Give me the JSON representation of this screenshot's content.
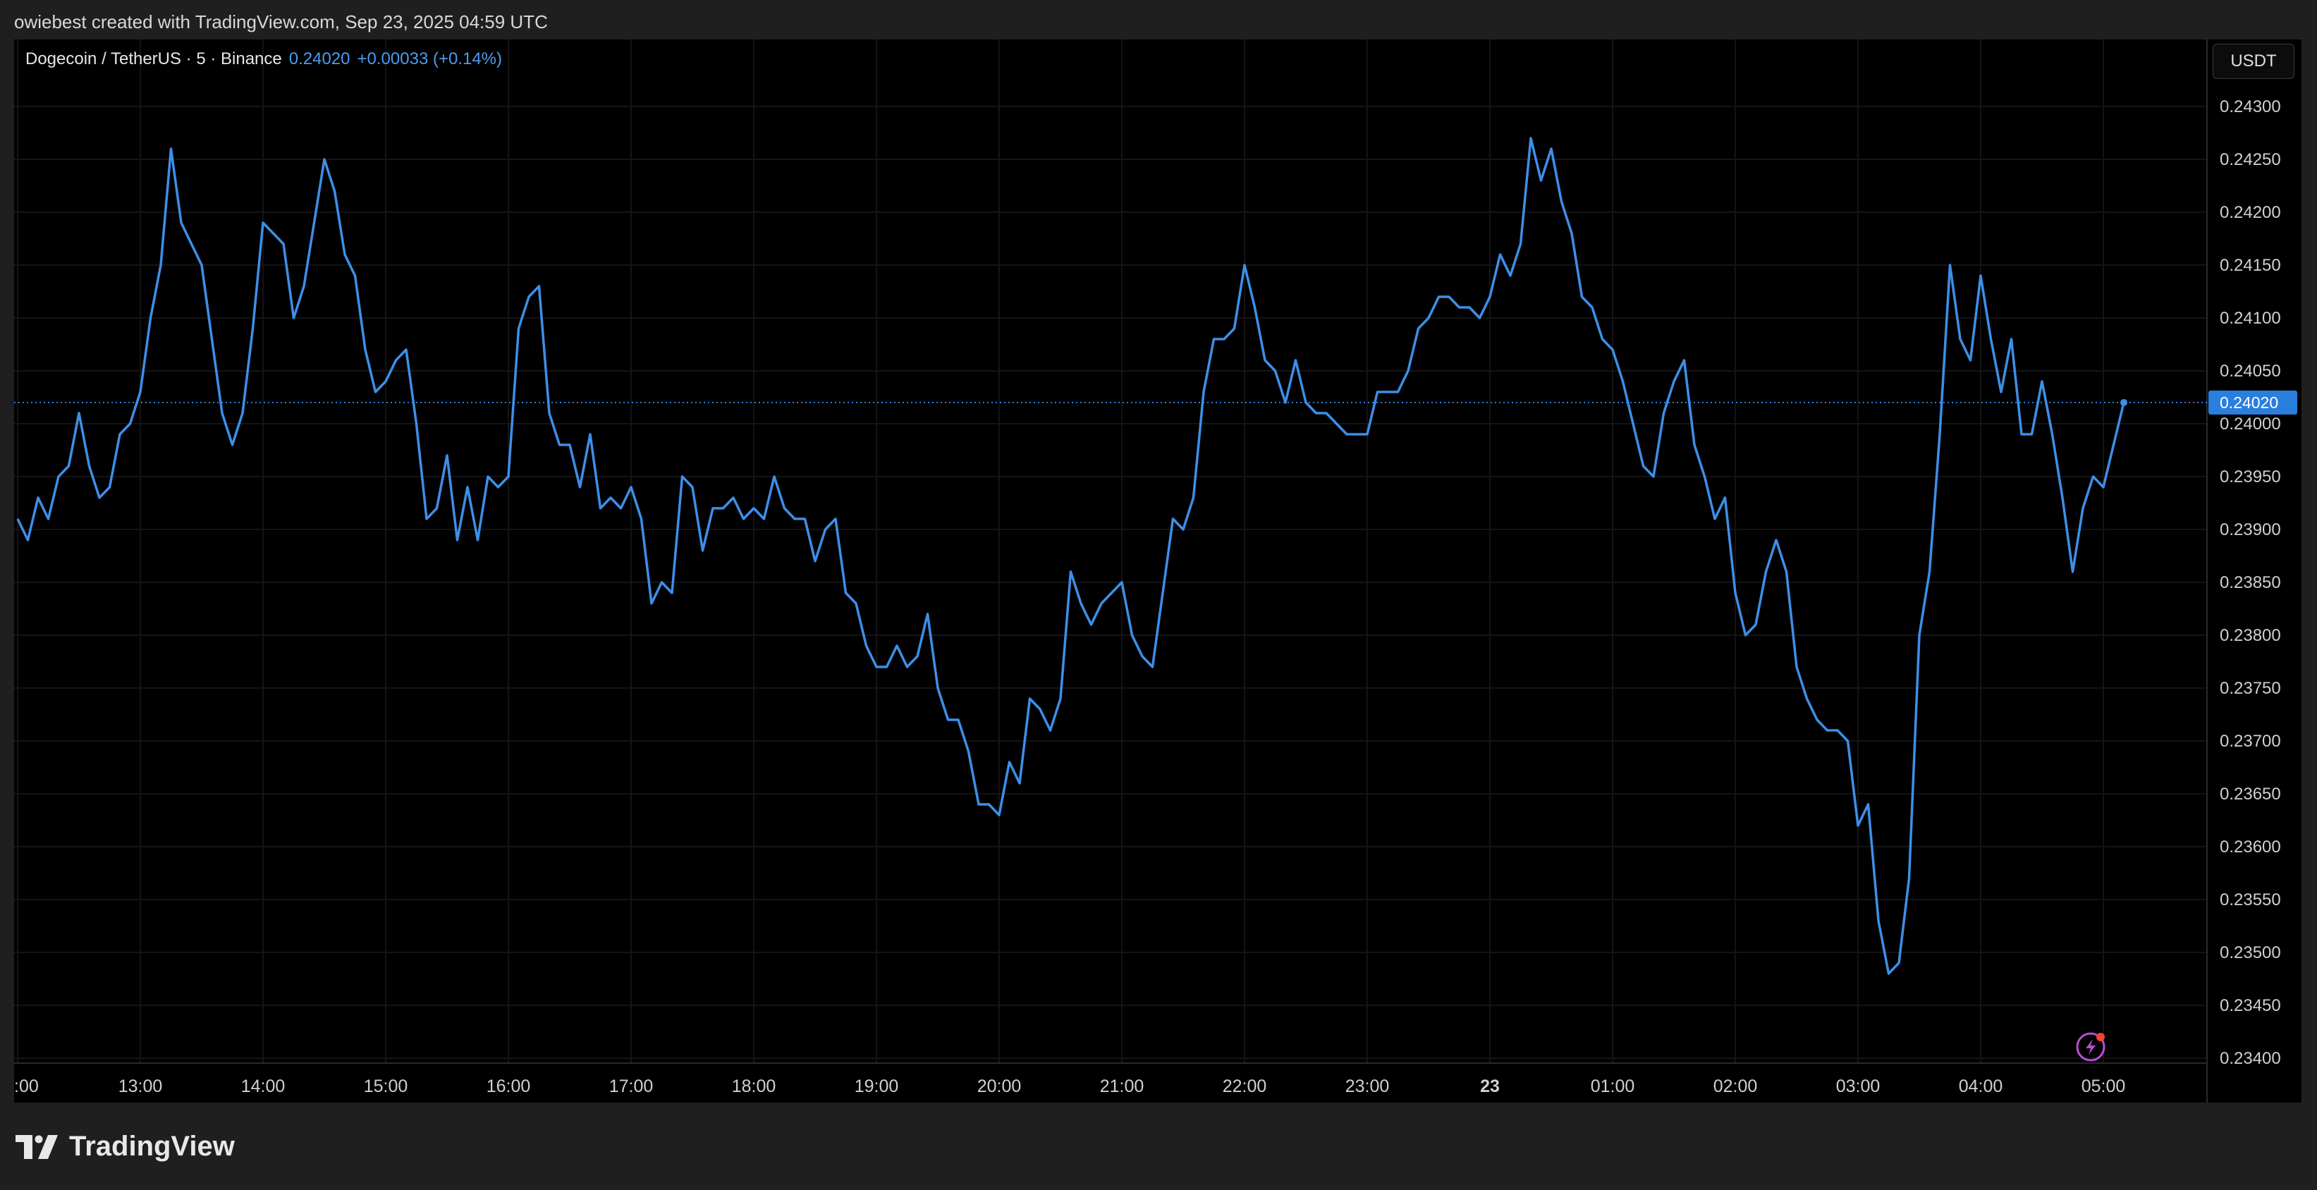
{
  "header": {
    "attribution": "owiebest created with TradingView.com, Sep 23, 2025 04:59 UTC"
  },
  "legend": {
    "symbol": "Dogecoin / TetherUS · 5 · Binance",
    "price": "0.24020",
    "change": "+0.00033 (+0.14%)"
  },
  "currency_button": {
    "label": "USDT"
  },
  "footer": {
    "brand": "TradingView"
  },
  "icons": {
    "brand_logo": "tradingview-logo-icon",
    "flash": "lightning-icon"
  },
  "colors": {
    "line": "#3d8fe8",
    "accent": "#2a7fde",
    "flash_icon": "#b44fd0",
    "flash_dot": "#f44336"
  },
  "chart_data": {
    "type": "line",
    "title": "Dogecoin / TetherUS · 5 · Binance",
    "xlabel": "",
    "ylabel": "",
    "ylim": [
      0.234,
      0.2431
    ],
    "x_ticks": [
      ":00",
      "13:00",
      "14:00",
      "15:00",
      "16:00",
      "17:00",
      "18:00",
      "19:00",
      "20:00",
      "21:00",
      "22:00",
      "23:00",
      "23",
      "01:00",
      "02:00",
      "03:00",
      "04:00",
      "05:00"
    ],
    "y_ticks": [
      "0.23400",
      "0.23450",
      "0.23500",
      "0.23550",
      "0.23600",
      "0.23650",
      "0.23700",
      "0.23750",
      "0.23800",
      "0.23850",
      "0.23900",
      "0.23950",
      "0.24000",
      "0.24050",
      "0.24100",
      "0.24150",
      "0.24200",
      "0.24250",
      "0.24300"
    ],
    "last_price_label": "0.24020",
    "last_price": 0.2402,
    "grid": true,
    "series": [
      {
        "values": [
          0.2391,
          0.2389,
          0.2393,
          0.2391,
          0.2395,
          0.2396,
          0.2401,
          0.2396,
          0.2393,
          0.2394,
          0.2399,
          0.24,
          0.2403,
          0.241,
          0.2415,
          0.2426,
          0.2419,
          0.2417,
          0.2415,
          0.2408,
          0.2401,
          0.2398,
          0.2401,
          0.2409,
          0.2419,
          0.2418,
          0.2417,
          0.241,
          0.2413,
          0.2419,
          0.2425,
          0.2422,
          0.2416,
          0.2414,
          0.2407,
          0.2403,
          0.2404,
          0.2406,
          0.2407,
          0.24,
          0.2391,
          0.2392,
          0.2397,
          0.2389,
          0.2394,
          0.2389,
          0.2395,
          0.2394,
          0.2395,
          0.2409,
          0.2412,
          0.2413,
          0.2401,
          0.2398,
          0.2398,
          0.2394,
          0.2399,
          0.2392,
          0.2393,
          0.2392,
          0.2394,
          0.2391,
          0.2383,
          0.2385,
          0.2384,
          0.2395,
          0.2394,
          0.2388,
          0.2392,
          0.2392,
          0.2393,
          0.2391,
          0.2392,
          0.2391,
          0.2395,
          0.2392,
          0.2391,
          0.2391,
          0.2387,
          0.239,
          0.2391,
          0.2384,
          0.2383,
          0.2379,
          0.2377,
          0.2377,
          0.2379,
          0.2377,
          0.2378,
          0.2382,
          0.2375,
          0.2372,
          0.2372,
          0.2369,
          0.2364,
          0.2364,
          0.2363,
          0.2368,
          0.2366,
          0.2374,
          0.2373,
          0.2371,
          0.2374,
          0.2386,
          0.2383,
          0.2381,
          0.2383,
          0.2384,
          0.2385,
          0.238,
          0.2378,
          0.2377,
          0.2384,
          0.2391,
          0.239,
          0.2393,
          0.2403,
          0.2408,
          0.2408,
          0.2409,
          0.2415,
          0.2411,
          0.2406,
          0.2405,
          0.2402,
          0.2406,
          0.2402,
          0.2401,
          0.2401,
          0.24,
          0.2399,
          0.2399,
          0.2399,
          0.2403,
          0.2403,
          0.2403,
          0.2405,
          0.2409,
          0.241,
          0.2412,
          0.2412,
          0.2411,
          0.2411,
          0.241,
          0.2412,
          0.2416,
          0.2414,
          0.2417,
          0.2427,
          0.2423,
          0.2426,
          0.2421,
          0.2418,
          0.2412,
          0.2411,
          0.2408,
          0.2407,
          0.2404,
          0.24,
          0.2396,
          0.2395,
          0.2401,
          0.2404,
          0.2406,
          0.2398,
          0.2395,
          0.2391,
          0.2393,
          0.2384,
          0.238,
          0.2381,
          0.2386,
          0.2389,
          0.2386,
          0.2377,
          0.2374,
          0.2372,
          0.2371,
          0.2371,
          0.237,
          0.2362,
          0.2364,
          0.2353,
          0.2348,
          0.2349,
          0.2357,
          0.238,
          0.2386,
          0.2399,
          0.2415,
          0.2408,
          0.2406,
          0.2414,
          0.2408,
          0.2403,
          0.2408,
          0.2399,
          0.2399,
          0.2404,
          0.2399,
          0.2393,
          0.2386,
          0.2392,
          0.2395,
          0.2394,
          0.2398,
          0.2402
        ]
      }
    ]
  }
}
